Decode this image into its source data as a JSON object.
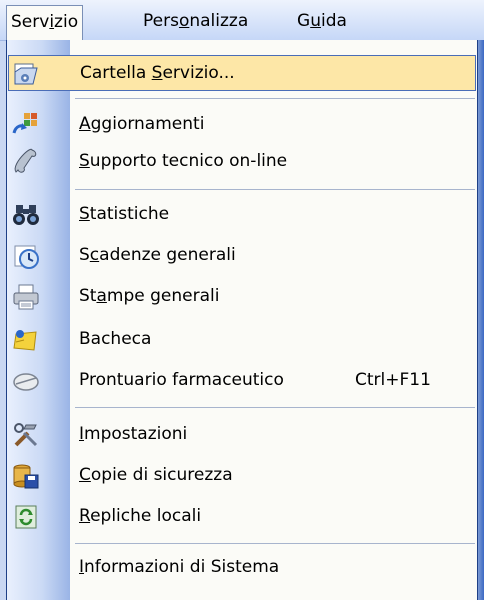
{
  "menubar": {
    "items": [
      {
        "pre": "Serv",
        "ul": "i",
        "post": "zio"
      },
      {
        "pre": "Pers",
        "ul": "o",
        "post": "nalizza"
      },
      {
        "pre": "G",
        "ul": "u",
        "post": "ida"
      }
    ]
  },
  "menu": {
    "items": [
      {
        "pre": "Cartella ",
        "ul": "S",
        "post": "ervizio...",
        "icon": "service-folder-icon"
      },
      {
        "pre": "",
        "ul": "A",
        "post": "ggiornamenti",
        "icon": "updates-icon"
      },
      {
        "pre": "",
        "ul": "S",
        "post": "upporto tecnico on-line",
        "icon": "phone-support-icon"
      },
      {
        "pre": "",
        "ul": "S",
        "post": "tatistiche",
        "icon": "binoculars-icon"
      },
      {
        "pre": "S",
        "ul": "c",
        "post": "adenze generali",
        "icon": "clock-icon"
      },
      {
        "pre": "St",
        "ul": "a",
        "post": "mpe generali",
        "icon": "printer-icon"
      },
      {
        "pre": "Bacheca",
        "ul": "",
        "post": "",
        "icon": "bulletin-board-icon"
      },
      {
        "pre": "Prontuario farmaceutico",
        "ul": "",
        "post": "",
        "shortcut": "Ctrl+F11",
        "icon": "pill-icon"
      },
      {
        "pre": "",
        "ul": "I",
        "post": "mpostazioni",
        "icon": "tools-icon"
      },
      {
        "pre": "",
        "ul": "C",
        "post": "opie di sicurezza",
        "icon": "backup-icon"
      },
      {
        "pre": "",
        "ul": "R",
        "post": "epliche locali",
        "icon": "local-replica-icon"
      },
      {
        "pre": "",
        "ul": "I",
        "post": "nformazioni di Sistema",
        "icon": "system-info-icon"
      }
    ]
  },
  "colors": {
    "highlight": "#fde7a7",
    "highlight_border": "#4a6db7",
    "menu_background": "#fbfbf7",
    "gutter_blue": "#9ab4e6"
  }
}
